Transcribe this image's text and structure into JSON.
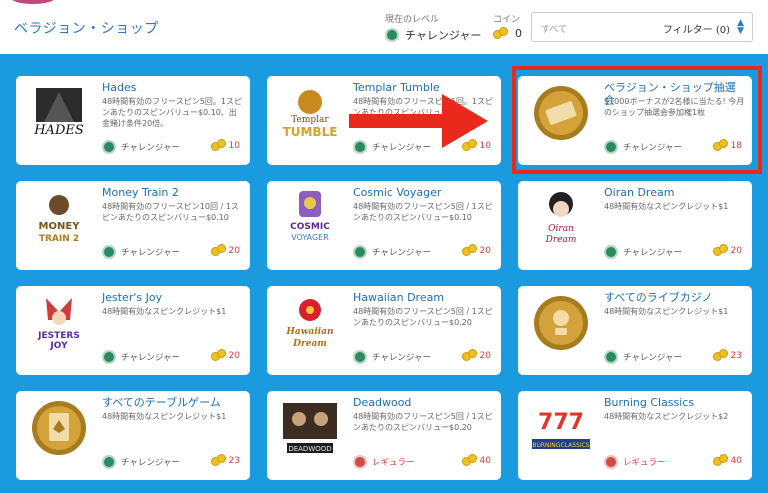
{
  "header": {
    "title": "ベラジョン・ショップ",
    "level_label": "現在のレベル",
    "level_value": "チャレンジャー",
    "coin_label": "コイン",
    "coin_value": "0",
    "filter_placeholder": "すべて",
    "filter_button": "フィルター (0)"
  },
  "cards": [
    {
      "title": "Hades",
      "desc": "48時間有効のフリースピン5回。1スピンあたりのスピンバリュー$0.10、出金賭け条件20倍。",
      "level": "チャレンジャー",
      "level_type": "challenger",
      "price": "10",
      "thumb": "hades-game-logo"
    },
    {
      "title": "Templar Tumble",
      "desc": "48時間有効のフリースピン5回。1スピンあたりのスピンバリュー",
      "level": "チャレンジャー",
      "level_type": "challenger",
      "price": "10",
      "thumb": "templar-tumble-logo"
    },
    {
      "title": "ベラジョン・ショップ抽選会",
      "desc": "$1000ボーナスが2名様に当たる! 今月のショップ抽選会参加権1枚",
      "level": "チャレンジャー",
      "level_type": "challenger",
      "price": "18",
      "thumb": "ticket-medal"
    },
    {
      "title": "Money Train 2",
      "desc": "48時間有効のフリースピン10回 / 1スピンあたりのスピンバリュー$0.10",
      "level": "チャレンジャー",
      "level_type": "challenger",
      "price": "20",
      "thumb": "money-train-logo"
    },
    {
      "title": "Cosmic Voyager",
      "desc": "48時間有効のフリースピン5回 / 1スピンあたりのスピンバリュー$0.10",
      "level": "チャレンジャー",
      "level_type": "challenger",
      "price": "20",
      "thumb": "cosmic-voyager-logo"
    },
    {
      "title": "Oiran Dream",
      "desc": "48時間有効なスピンクレジット$1",
      "level": "チャレンジャー",
      "level_type": "challenger",
      "price": "20",
      "thumb": "oiran-dream-logo"
    },
    {
      "title": "Jester's Joy",
      "desc": "48時間有効なスピンクレジット$1",
      "level": "チャレンジャー",
      "level_type": "challenger",
      "price": "20",
      "thumb": "jesters-joy-logo"
    },
    {
      "title": "Hawaiian Dream",
      "desc": "48時間有効のフリースピン5回 / 1スピンあたりのスピンバリュー$0.20",
      "level": "チャレンジャー",
      "level_type": "challenger",
      "price": "20",
      "thumb": "hawaiian-dream-logo"
    },
    {
      "title": "すべてのライブカジノ",
      "desc": "48時間有効なスピンクレジット$1",
      "level": "チャレンジャー",
      "level_type": "challenger",
      "price": "23",
      "thumb": "dealer-medal"
    },
    {
      "title": "すべてのテーブルゲーム",
      "desc": "48時間有効なスピンクレジット$1",
      "level": "チャレンジャー",
      "level_type": "challenger",
      "price": "23",
      "thumb": "card-medal"
    },
    {
      "title": "Deadwood",
      "desc": "48時間有効のフリースピン5回 / 1スピンあたりのスピンバリュー$0.20",
      "level": "レギュラー",
      "level_type": "regular",
      "price": "40",
      "thumb": "deadwood-logo"
    },
    {
      "title": "Burning Classics",
      "desc": "48時間有効なスピンクレジット$2",
      "level": "レギュラー",
      "level_type": "regular",
      "price": "40",
      "thumb": "burning-classics-logo"
    }
  ],
  "thumb_text": {
    "hades": "HADES",
    "templar_1": "Templar",
    "templar_2": "TUMBLE",
    "money": "MONEY",
    "train": "TRAIN 2",
    "cosmic": "COSMIC",
    "voyager": "VOYAGER",
    "oiran": "Oiran",
    "oiran_2": "Dream",
    "jesters": "JESTERS",
    "joy": "JOY",
    "hawaiian": "Hawaiian",
    "hawaiian_2": "Dream",
    "deadwood": "DEADWOOD",
    "burning": "BURNINGCLASSICS",
    "sevens": "777"
  },
  "colors": {
    "background": "#1a9be0",
    "accent": "#1a6fb8",
    "price": "#d94040",
    "highlight": "#e8291c"
  }
}
